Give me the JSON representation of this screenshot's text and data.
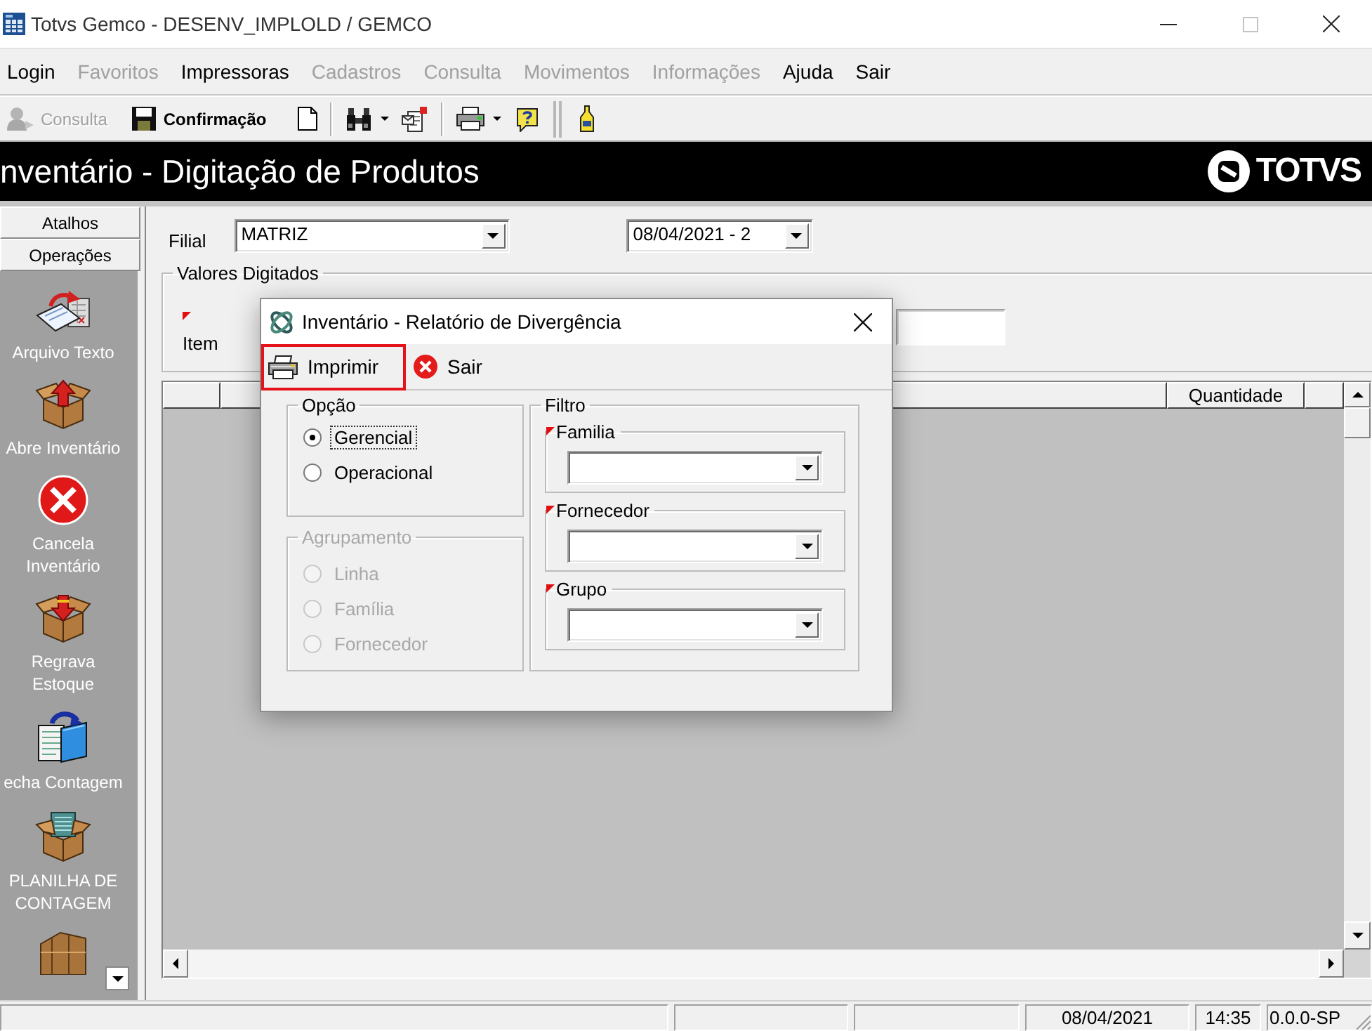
{
  "window": {
    "title": "Totvs Gemco - DESENV_IMPLOLD / GEMCO"
  },
  "menu": [
    {
      "label": "Login",
      "disabled": false
    },
    {
      "label": "Favoritos",
      "disabled": true
    },
    {
      "label": "Impressoras",
      "disabled": false
    },
    {
      "label": "Cadastros",
      "disabled": true
    },
    {
      "label": "Consulta",
      "disabled": true
    },
    {
      "label": "Movimentos",
      "disabled": true
    },
    {
      "label": "Informações",
      "disabled": true
    },
    {
      "label": "Ajuda",
      "disabled": false
    },
    {
      "label": "Sair",
      "disabled": false
    }
  ],
  "toolbar": {
    "buttons": [
      {
        "label": "Consulta",
        "disabled": true
      },
      {
        "label": "Confirmação",
        "disabled": false
      }
    ]
  },
  "header": {
    "title": "nventário - Digitação de Produtos",
    "logo": "TOTVS"
  },
  "sidebar": {
    "tabs": [
      "Atalhos",
      "Operações"
    ],
    "items": [
      {
        "label": "Arquivo Texto"
      },
      {
        "label": "Abre Inventário"
      },
      {
        "label": "Cancela Inventário"
      },
      {
        "label": "Regrava Estoque"
      },
      {
        "label": "echa Contagem"
      },
      {
        "label": "PLANILHA DE CONTAGEM"
      }
    ]
  },
  "form": {
    "filial": {
      "label": "Filial",
      "value": "MATRIZ"
    },
    "period": {
      "value": "08/04/2021 - 2"
    },
    "values_group": {
      "title": "Valores Digitados",
      "item_label": "Item",
      "item_required": true
    }
  },
  "grid": {
    "columns": [
      {
        "label": "Quantidade"
      }
    ]
  },
  "dialog": {
    "title": "Inventário - Relatório de Divergência",
    "buttons": [
      {
        "kind": "print",
        "label": "Imprimir",
        "highlighted": true
      },
      {
        "kind": "exit",
        "label": "Sair",
        "highlighted": false
      }
    ],
    "option_groups": [
      {
        "title": "Opção",
        "disabled": false,
        "options": [
          {
            "label": "Gerencial",
            "selected": true,
            "focused": true
          },
          {
            "label": "Operacional",
            "selected": false,
            "focused": false
          }
        ]
      },
      {
        "title": "Agrupamento",
        "disabled": true,
        "options": [
          {
            "label": "Linha",
            "selected": false,
            "focused": false
          },
          {
            "label": "Família",
            "selected": false,
            "focused": false
          },
          {
            "label": "Fornecedor",
            "selected": false,
            "focused": false
          }
        ]
      }
    ],
    "filter": {
      "title": "Filtro",
      "fields": [
        {
          "label": "Familia",
          "required": true
        },
        {
          "label": "Fornecedor",
          "required": true
        },
        {
          "label": "Grupo",
          "required": true
        }
      ]
    }
  },
  "status_bar": {
    "date": "08/04/2021",
    "time": "14:35",
    "version": "0.0.0-SP"
  }
}
